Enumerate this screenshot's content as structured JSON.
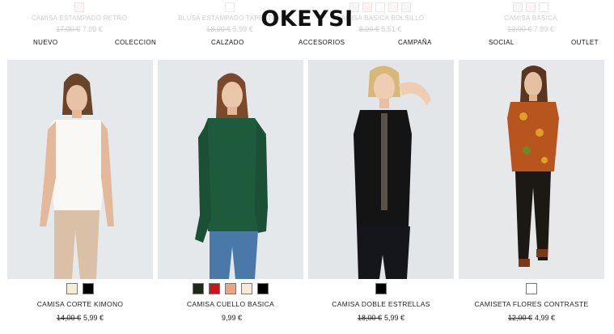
{
  "brand": "OKEYSI",
  "nav": [
    "NUEVO",
    "COLECCION",
    "CALZADO",
    "ACCESORIOS",
    "CAMPAÑA",
    "SOCIAL",
    "OUTLET"
  ],
  "ghost_products": [
    {
      "name": "CAMISA ESTAMPADO RETRO",
      "old_price": "17,00 €",
      "price": "7,99 €",
      "swatches": [
        "#f4d7d7"
      ]
    },
    {
      "name": "BLUSA ESTAMPADO TAPESTRY",
      "old_price": "18,00 €",
      "price": "5,99 €",
      "swatches": [
        "#ffffff"
      ]
    },
    {
      "name": "CAMISA BASICA BOLSILLO",
      "old_price": "8,00 €",
      "price": "5,51 €",
      "swatches": [
        "#d8d8d8",
        "#f1c9c9",
        "#ffffff",
        "#f4d7d7",
        "#d8d8d8"
      ]
    },
    {
      "name": "CAMISA BASICA",
      "old_price": "10,00 €",
      "price": "7,99 €",
      "swatches": [
        "#d8d8d8",
        "#f4d7d7",
        "#ffffff"
      ]
    }
  ],
  "products": [
    {
      "name": "CAMISA CORTE KIMONO",
      "old_price": "14,00 €",
      "price": "5,99 €",
      "swatches": [
        "#f5ecd5",
        "#000000"
      ]
    },
    {
      "name": "CAMISA CUELLO BASICA",
      "old_price": "",
      "price": "9,99 €",
      "swatches": [
        "#1f2a12",
        "#c8141c",
        "#e8a584",
        "#f4ead6",
        "#000000"
      ]
    },
    {
      "name": "CAMISA DOBLE ESTRELLAS",
      "old_price": "18,00 €",
      "price": "5,99 €",
      "swatches": [
        "#000000"
      ]
    },
    {
      "name": "CAMISETA FLORES CONTRASTE",
      "old_price": "12,00 €",
      "price": "4,99 €",
      "swatches": [
        "#ffffff"
      ]
    }
  ]
}
